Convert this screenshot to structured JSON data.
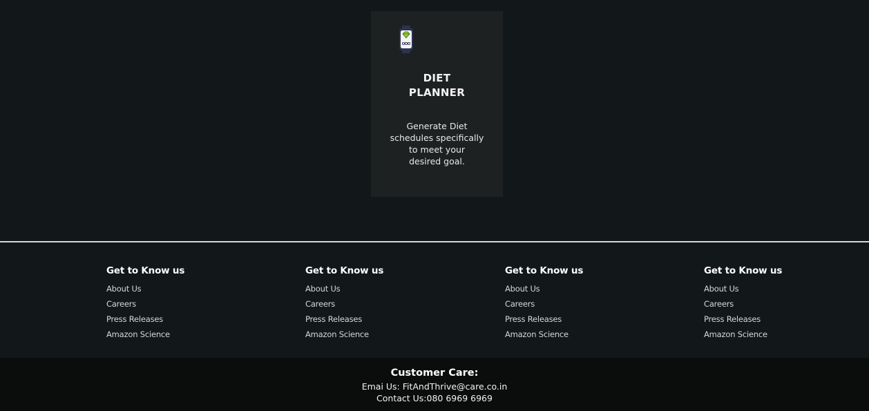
{
  "card": {
    "icon": "smartwatch-icon",
    "title_line1": "DIET",
    "title_line2": "PLANNER",
    "desc_line1": "Generate Diet",
    "desc_line2": "schedules specifically",
    "desc_line3": "to meet your",
    "desc_line4": "desired goal."
  },
  "footer": {
    "columns": [
      {
        "heading": "Get to Know us",
        "links": [
          "About Us",
          "Careers",
          "Press Releases",
          "Amazon Science"
        ]
      },
      {
        "heading": "Get to Know us",
        "links": [
          "About Us",
          "Careers",
          "Press Releases",
          "Amazon Science"
        ]
      },
      {
        "heading": "Get to Know us",
        "links": [
          "About Us",
          "Careers",
          "Press Releases",
          "Amazon Science"
        ]
      },
      {
        "heading": "Get to Know us",
        "links": [
          "About Us",
          "Careers",
          "Press Releases",
          "Amazon Science"
        ]
      }
    ]
  },
  "customer_care": {
    "title": "Customer Care:",
    "email": "Emai Us: FitAndThrive@care.co.in",
    "contact": "Contact Us:080 6969 6969"
  },
  "colors": {
    "page_bg": "#121819",
    "card_bg": "#1e2122",
    "bottom_bar_bg": "#0b0c0c",
    "icon_accent": "#8fd12f",
    "watch_strap": "#2c3350"
  }
}
